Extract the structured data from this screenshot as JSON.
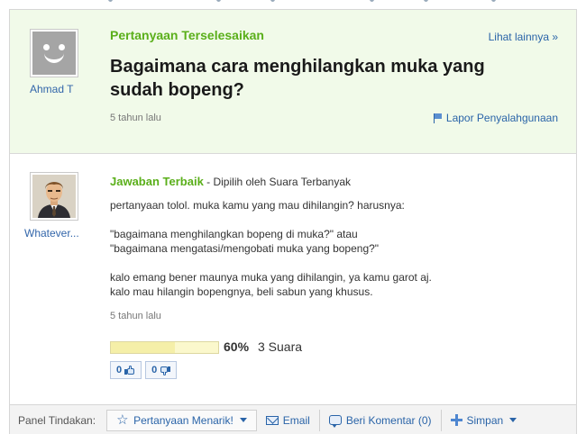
{
  "question": {
    "section_title": "Pertanyaan Terselesaikan",
    "see_more": "Lihat lainnya »",
    "asker": "Ahmad T",
    "text": "Bagaimana cara menghilangkan muka yang sudah bopeng?",
    "time": "5 tahun lalu",
    "report": "Lapor Penyalahgunaan"
  },
  "answer": {
    "answerer": "Whatever...",
    "best_label": "Jawaban Terbaik",
    "chosen_by": " - Dipilih oleh Suara Terbanyak",
    "lines": [
      "pertanyaan tolol. muka kamu yang mau dihilangin? harusnya:",
      "",
      "\"bagaimana menghilangkan bopeng di muka?\" atau",
      "\"bagaimana mengatasi/mengobati muka yang bopeng?\"",
      "",
      "kalo emang bener maunya muka yang dihilangin, ya kamu garot aj.",
      "kalo mau hilangin bopengnya, beli sabun yang khusus."
    ],
    "time": "5 tahun lalu",
    "vote_percent": "60%",
    "vote_fraction": 0.6,
    "vote_count": "3 Suara",
    "thumbs_up": "0",
    "thumbs_down": "0"
  },
  "panel": {
    "label": "Panel Tindakan:",
    "interesting": "Pertanyaan Menarik!",
    "email": "Email",
    "comment": "Beri Komentar (0)",
    "save": "Simpan"
  },
  "colors": {
    "question_bg": "#f1fae9",
    "accent_green": "#5aaf1a",
    "link_blue": "#2a64a8"
  }
}
